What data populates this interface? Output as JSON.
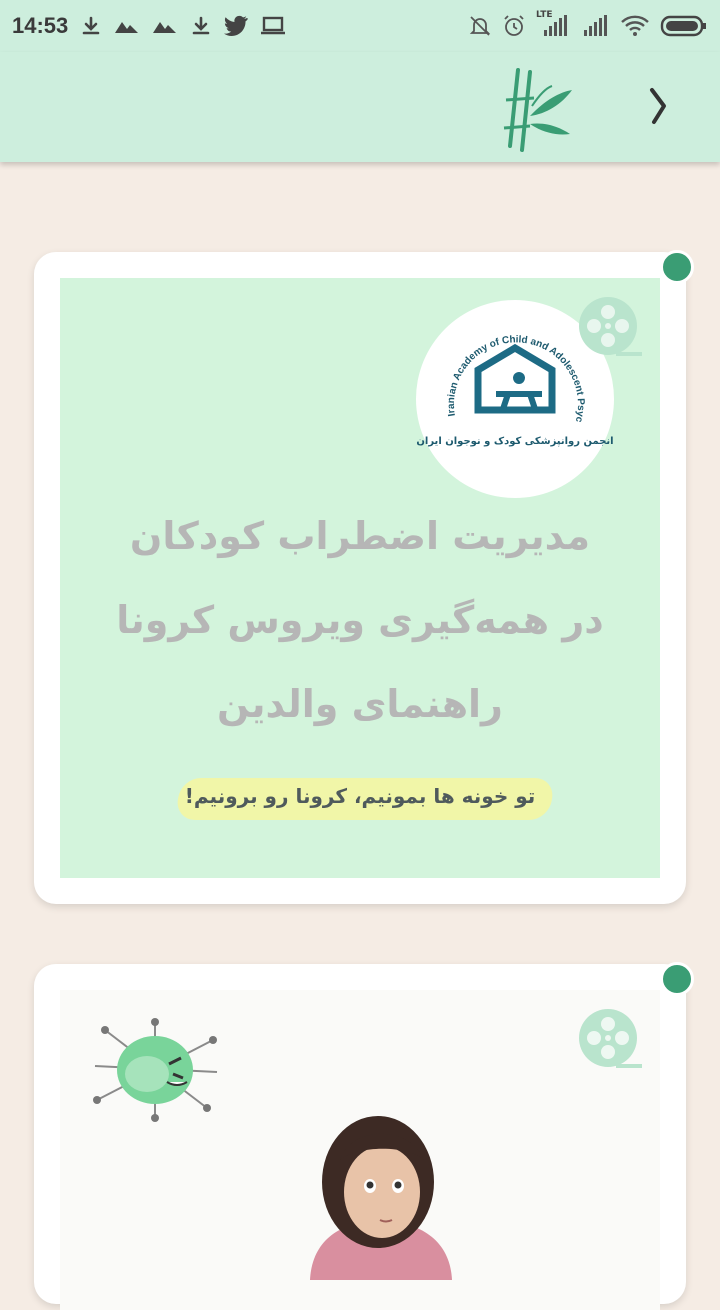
{
  "status_bar": {
    "time": "14:53",
    "network_label": "LTE",
    "left_icons": [
      "download-icon",
      "mountain-icon",
      "mountain-icon",
      "download-icon",
      "twitter-icon",
      "laptop-icon"
    ],
    "right_icons": [
      "bell-off-icon",
      "alarm-icon",
      "signal-icon",
      "signal-icon",
      "wifi-icon",
      "battery-icon"
    ]
  },
  "app_bar": {
    "logo": "bamboo-logo-icon",
    "back": "chevron-right-icon",
    "background": "#cdeedd"
  },
  "cards": [
    {
      "status_dot_color": "#3a9d74",
      "media_icon": "film-reel-icon",
      "emblem_ring_text": "Iranian Academy of Child and Adolescent Psychiatry",
      "emblem_text": "انجمن روانپزشکی کودک و نوجوان ایران",
      "headline": [
        "مدیریت اضطراب کودکان",
        "در همه‌گیری ویروس کرونا",
        "راهنمای والدین"
      ],
      "tagline": "تو خونه ها بمونیم، کرونا رو برونیم!"
    },
    {
      "status_dot_color": "#3a9d74",
      "media_icon": "film-reel-icon",
      "illustration": "virus-and-child-illustration"
    }
  ],
  "colors": {
    "page_bg": "#f5ece4",
    "accent_green": "#3a9d74",
    "thumb_green": "#d3f4dc",
    "highlight_yellow": "#f1f6a8"
  }
}
